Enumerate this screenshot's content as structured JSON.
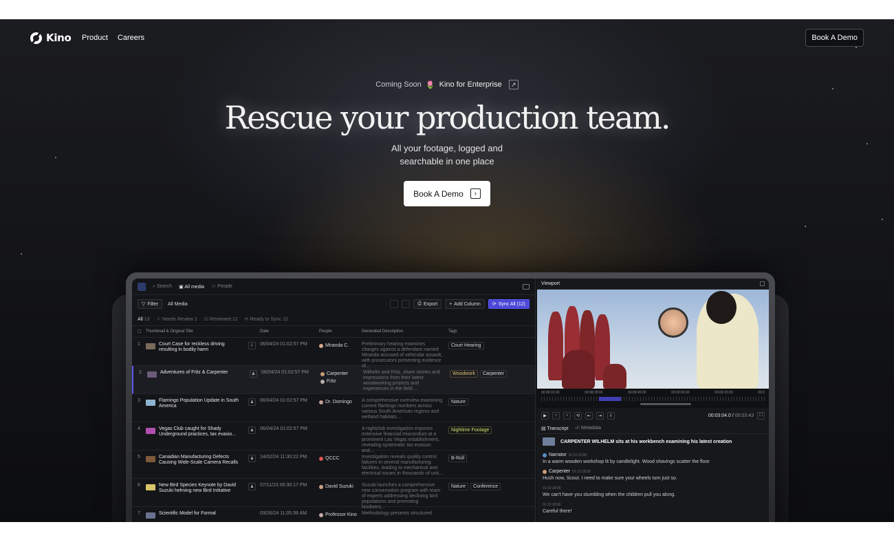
{
  "nav": {
    "brand": "Kino",
    "links": [
      "Product",
      "Careers"
    ],
    "cta": "Book A Demo"
  },
  "hero": {
    "badge_prefix": "Coming Soon",
    "badge_emoji": "🌷",
    "badge_link": "Kino for Enterprise",
    "headline": "Rescue your production team.",
    "sub_line1": "All your footage, logged and",
    "sub_line2": "searchable in one place",
    "cta": "Book A Demo"
  },
  "app": {
    "topbar": {
      "search": "Search",
      "all_media": "All media",
      "people": "People"
    },
    "toolbar": {
      "filter": "Filter",
      "scope": "All Media",
      "export": "Export",
      "add_column": "Add Column",
      "sync": "Sync All (12)"
    },
    "filters": [
      {
        "label": "All",
        "count": "13"
      },
      {
        "label": "Needs Review",
        "count": "1"
      },
      {
        "label": "Reviewed",
        "count": "12"
      },
      {
        "label": "Ready to Sync",
        "count": "12"
      }
    ],
    "columns": {
      "title": "Thumbnail & Original Title",
      "date": "Date",
      "people": "People",
      "desc": "Generated Description",
      "tags": "Tags"
    },
    "rows": [
      {
        "n": "1",
        "title": "Court Case for reckless driving resulting in bodily harm",
        "date": "06/04/24 01:02:57 PM",
        "people": [
          "Miranda C."
        ],
        "desc": "Preliminary hearing examines charges against a defendant named Miranda accused of vehicular assault, with prosecutors presenting evidence of...",
        "tags": [
          "Court Hearing"
        ]
      },
      {
        "n": "2",
        "title": "Adventures of Fritz & Carpenter",
        "date": "06/04/24 01:02:57 PM",
        "people": [
          "Carpenter",
          "Fritz"
        ],
        "desc": "Wilhelm and Fritz, share stories and impressions from their latest woodworking projects and experiences in the field....",
        "tags": [
          "Woodwork",
          "Carpenter"
        ]
      },
      {
        "n": "3",
        "title": "Flamingo Population Update in South America",
        "date": "06/04/24 01:02:57 PM",
        "people": [
          "Dr. Domingo"
        ],
        "desc": "A comprehensive overview examining current flamingo numbers across various South American regions and wetland habitats....",
        "tags": [
          "Nature"
        ]
      },
      {
        "n": "4",
        "title": "Vegas Club caught for Shady Underground practices, tax evasio...",
        "date": "06/04/24 01:02:57 PM",
        "people": [],
        "desc": "A nightclub investigation exposes extensive financial misconduct at a prominent Las Vegas establishment, revealing systematic tax evasion and...",
        "tags": [
          "Nightime Footage"
        ]
      },
      {
        "n": "5",
        "title": "Canadian Manufacturing Defects Causing Wide-Scale Camera Recalls",
        "date": "14/02/24 11:30:22 PM",
        "people": [
          "QCCC"
        ],
        "desc": "Investigation reveals quality control failures in several manufacturing facilities, leading to mechanical and electrical issues in thousands of unit...",
        "tags": [
          "B-Roll"
        ]
      },
      {
        "n": "6",
        "title": "New Bird Species Keynote by David Suzuki helming new Bird Initiative",
        "date": "07/11/23 06:30:17 PM",
        "people": [
          "David Suzuki"
        ],
        "desc": "Suzuki launches a comprehensive new conservation program with team of experts addressing declining bird populations and promoting biodivers...",
        "tags": [
          "Nature",
          "Conference"
        ]
      },
      {
        "n": "7",
        "title": "Scientific Model for Formal",
        "date": "03/26/24 11:05:39 AM",
        "people": [
          "Professor Kino"
        ],
        "desc": "Methodology presents structured",
        "tags": []
      }
    ],
    "viewport": {
      "title": "Viewport",
      "tl_labels": [
        "00:08:15:00",
        "00:08:29:00",
        "00:08:45:00",
        "00:09:00:00",
        "00:09:15:00",
        "00:0"
      ],
      "timecode": "00:03:04.0",
      "total": "00:03:43",
      "tabs": [
        "Transcript",
        "Metadata"
      ],
      "clip_title": "CARPENTER WILHELM sits at his workbench examining his latest creation",
      "transcript": [
        {
          "speaker": "Narrator",
          "time": "01:12:12;06",
          "text": "In a warm wooden workshop lit by candlelight. Wood shavings scatter the floor"
        },
        {
          "speaker": "Carpenter",
          "time": "01:12:18;00",
          "text": "Hush now, Scout. I need to make sure your wheels turn just so."
        },
        {
          "speaker": "",
          "time": "01:12:18;00",
          "text": "We can't have you stumbling when the children pull you along."
        },
        {
          "speaker": "",
          "time": "01:12:18;00",
          "text": "Careful there!"
        }
      ]
    }
  }
}
